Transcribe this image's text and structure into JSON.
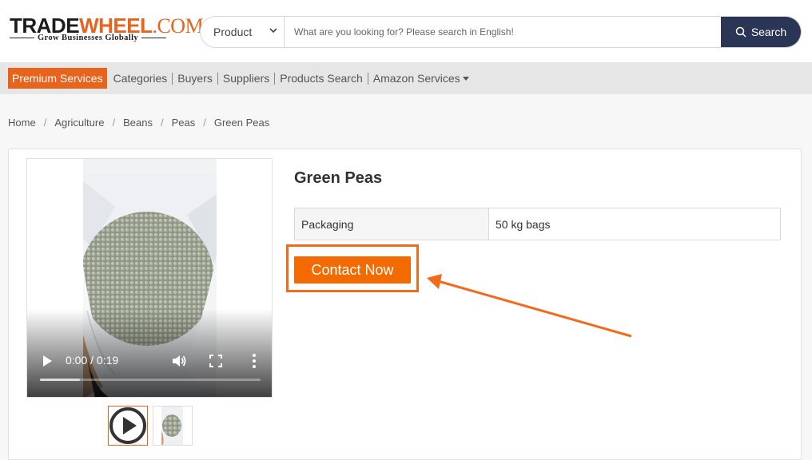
{
  "header": {
    "logo": {
      "part1": "TRADE",
      "part2": "WHEEL",
      "part3": ".COM",
      "tagline": "Grow Businesses Globally"
    },
    "search": {
      "category": "Product",
      "placeholder": "What are you looking for? Please search in English!",
      "value": "",
      "button_label": "Search"
    }
  },
  "nav": {
    "premium_label": "Premium Services",
    "items": [
      "Categories",
      "Buyers",
      "Suppliers",
      "Products Search",
      "Amazon Services"
    ]
  },
  "breadcrumb": [
    "Home",
    "Agriculture",
    "Beans",
    "Peas",
    "Green Peas"
  ],
  "product": {
    "title": "Green Peas",
    "specs": [
      {
        "key": "Packaging",
        "value": "50 kg bags"
      }
    ],
    "contact_label": "Contact Now"
  },
  "video": {
    "time": "0:00 / 0:19",
    "progress": 0.18
  },
  "colors": {
    "brand_orange": "#e8631c",
    "search_button": "#2b3556",
    "annotation": "#f26a1b"
  }
}
